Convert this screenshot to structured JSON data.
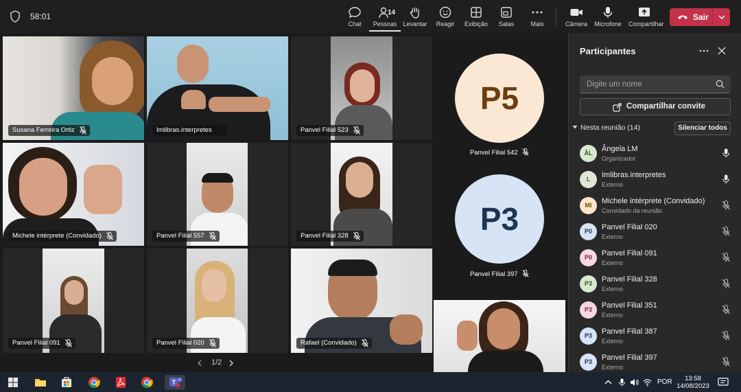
{
  "topbar": {
    "timer": "58:01",
    "people_count": "14",
    "buttons": {
      "chat": "Chat",
      "people": "Pessoas",
      "raise": "Levantar",
      "react": "Reagir",
      "view": "Exibição",
      "rooms": "Salas",
      "more": "Mais",
      "camera": "Câmera",
      "mic": "Microfone",
      "share": "Compartilhar"
    },
    "leave": "Sair",
    "leave_color": "#c4314b"
  },
  "grid": {
    "tiles": [
      {
        "name": "Susana Ferreira Ortiz"
      },
      {
        "name": "Imlibras.interpretes"
      },
      {
        "name": "Panvel Filial 523"
      },
      {
        "name": "Michele intérprete (Convidado)"
      },
      {
        "name": "Panvel Filial 557"
      },
      {
        "name": "Panvel Filial 328"
      },
      {
        "name": "Panvel Filial 091"
      },
      {
        "name": "Panvel Filial 020"
      },
      {
        "name": "Rafael (Convidado)"
      }
    ],
    "avatars": [
      {
        "initials": "P5",
        "name": "Panvel Filial 542",
        "bg": "#fbe8d4",
        "fg": "#6b3d10"
      },
      {
        "initials": "P3",
        "name": "Panvel Filial 397",
        "bg": "#d6e4f5",
        "fg": "#1e3552"
      }
    ],
    "pager": "1/2"
  },
  "panel": {
    "title": "Participantes",
    "search_placeholder": "Digite um nome",
    "share_invite": "Compartilhar convite",
    "section": "Nesta reunião (14)",
    "mute_all": "Silenciar todos",
    "participants": [
      {
        "initials": "ÂL",
        "name": "Ângela LM",
        "role": "Organizador",
        "bg": "#d8e8d0",
        "fg": "#3b5a2a",
        "mic": "on"
      },
      {
        "initials": "L",
        "name": "Imlibras.interpretes",
        "role": "Externo",
        "bg": "#e0e6d8",
        "fg": "#4a5a3a",
        "mic": "on"
      },
      {
        "initials": "MI",
        "name": "Michele intérprete (Convidado)",
        "role": "Convidado da reunião",
        "bg": "#fbe4c8",
        "fg": "#7a4a12",
        "mic": "off"
      },
      {
        "initials": "P0",
        "name": "Panvel Filial 020",
        "role": "Externo",
        "bg": "#d6e4f5",
        "fg": "#1e3552",
        "mic": "off"
      },
      {
        "initials": "P0",
        "name": "Panvel Filial 091",
        "role": "Externo",
        "bg": "#f8d8e0",
        "fg": "#7a2240",
        "mic": "off"
      },
      {
        "initials": "P3",
        "name": "Panvel Filial 328",
        "role": "Externo",
        "bg": "#d8e8d0",
        "fg": "#3b5a2a",
        "mic": "off"
      },
      {
        "initials": "P3",
        "name": "Panvel Filial 351",
        "role": "Externo",
        "bg": "#f8d8e0",
        "fg": "#7a2240",
        "mic": "off"
      },
      {
        "initials": "P3",
        "name": "Panvel Filial 387",
        "role": "Externo",
        "bg": "#d6e4f5",
        "fg": "#1e3552",
        "mic": "off"
      },
      {
        "initials": "P3",
        "name": "Panvel Filial 397",
        "role": "Externo",
        "bg": "#d6e4f5",
        "fg": "#1e3552",
        "mic": "off"
      }
    ]
  },
  "taskbar": {
    "lang": "POR",
    "time": "13:58",
    "date": "14/08/2023"
  }
}
